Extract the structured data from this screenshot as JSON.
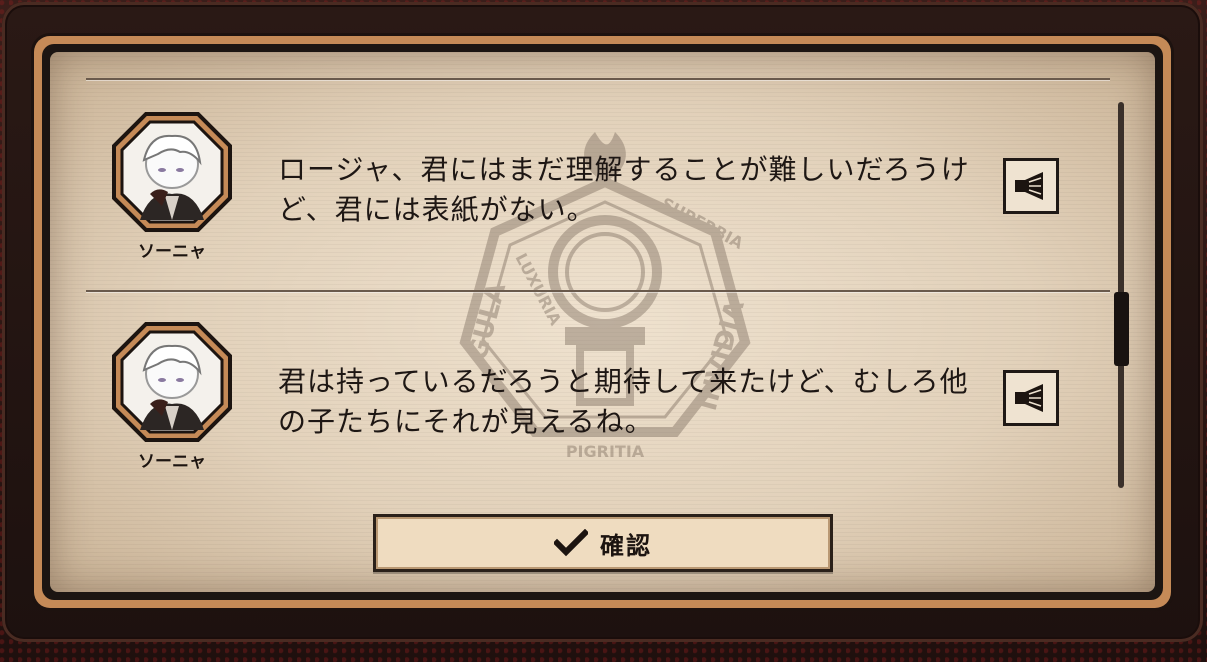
{
  "dialogue_log": {
    "entries": [
      {
        "speaker": "ソーニャ",
        "text": "ロージャ、君にはまだ理解することが難しいだろうけど、君には表紙がない。",
        "voice_icon": "speaker-icon"
      },
      {
        "speaker": "ソーニャ",
        "text": "君は持っているだろうと期待して来たけど、むしろ他の子たちにそれが見えるね。",
        "voice_icon": "speaker-icon"
      }
    ],
    "emblem_words": [
      "GULA",
      "LUXURIA",
      "SUPERBIA",
      "INVIDIA",
      "PIGRITIA"
    ],
    "confirm_icon": "checkmark-icon",
    "confirm_label": "確認"
  },
  "colors": {
    "panel_border": "#c58a57",
    "paper": "#e8d8c2",
    "text": "#1e1714",
    "background_dark": "#2a1714"
  }
}
